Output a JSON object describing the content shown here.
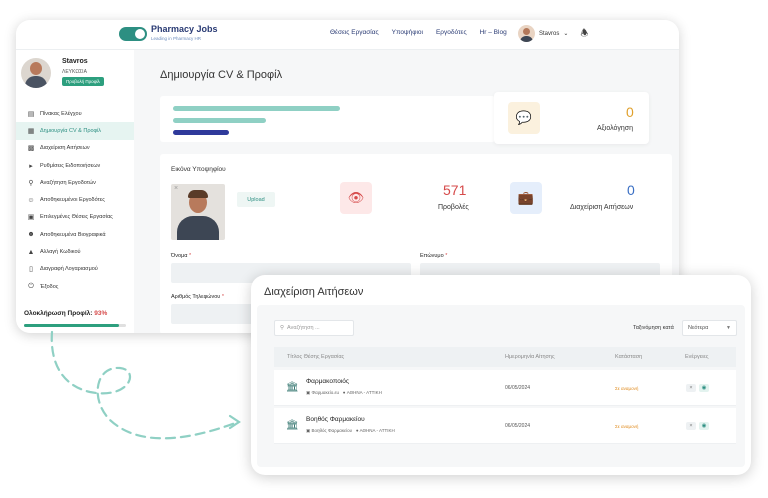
{
  "brand": {
    "name": "Pharmacy Jobs",
    "tagline": "Leading in Pharmacy HR",
    "accent": "#2d8f82"
  },
  "nav": {
    "items": [
      "Θέσεις Εργασίας",
      "Υποψήφιοι",
      "Εργοδότες",
      "Hr – Blog"
    ],
    "user": "Stavros"
  },
  "profile": {
    "name": "Stavros",
    "city": "ΛΕΥΚΩΣΙΑ",
    "button": "Προβολή Προφίλ"
  },
  "sidebar": {
    "items": [
      {
        "label": "Πίνακας Ελέγχου",
        "icon": "dashboard-icon"
      },
      {
        "label": "Δημιουργία CV & Προφίλ",
        "icon": "cv-icon"
      },
      {
        "label": "Διαχείριση Αιτήσεων",
        "icon": "applications-icon"
      },
      {
        "label": "Ρυθμίσεις Ειδοποιήσεων",
        "icon": "megaphone-icon"
      },
      {
        "label": "Αναζήτηση Εργοδοτών",
        "icon": "search-icon"
      },
      {
        "label": "Αποθηκευμένοι Εργοδότες",
        "icon": "user-icon"
      },
      {
        "label": "Επιλεγμένες Θέσεις Εργασίας",
        "icon": "bookmark-icon"
      },
      {
        "label": "Αποθηκευμένα Βιογραφικά",
        "icon": "users-icon"
      },
      {
        "label": "Αλλαγή Κωδικού",
        "icon": "lock-icon"
      },
      {
        "label": "Διαγραφή Λογαριασμού",
        "icon": "trash-icon"
      },
      {
        "label": "Έξοδος",
        "icon": "power-icon"
      }
    ],
    "completion_label": "Ολοκλήρωση Προφίλ:",
    "completion_value": "93%",
    "completion_fraction": 0.93
  },
  "main": {
    "title": "Δημιουργία CV & Προφίλ",
    "rating": {
      "value": "0",
      "label": "Αξιολόγηση"
    },
    "views": {
      "value": "571",
      "label": "Προβολές"
    },
    "applications": {
      "value": "0",
      "label": "Διαχείριση Αιτήσεων"
    },
    "photo_label": "Εικόνα Υποψηφίου",
    "upload": "Upload",
    "fields": {
      "first_name": "Όνομα",
      "last_name": "Επώνυμο",
      "phone": "Αριθμός Τηλεφώνου"
    },
    "required_mark": "*"
  },
  "applications_panel": {
    "title": "Διαχείριση Αιτήσεων",
    "search_placeholder": "Αναζήτηση ...",
    "sort_label": "Ταξινόμηση κατά",
    "sort_value": "Νεότερα",
    "columns": [
      "Τίτλος Θέσης Εργασίας",
      "Ημερομηνία Αίτησης",
      "Κατάσταση",
      "Ενέργειες"
    ],
    "rows": [
      {
        "title": "Φαρμακοποιός",
        "company": "Φαρμακείο.εu",
        "location": "ΑΘΗΝΑ - ΑΤΤΙΚΗ",
        "date": "06/05/2024",
        "status": "Σε αναμονή"
      },
      {
        "title": "Βοηθός Φαρμακείου",
        "company": "Βοηθός Φαρμακείου",
        "location": "ΑΘΗΝΑ - ΑΤΤΙΚΗ",
        "date": "06/05/2024",
        "status": "Σε αναμονή"
      }
    ]
  }
}
